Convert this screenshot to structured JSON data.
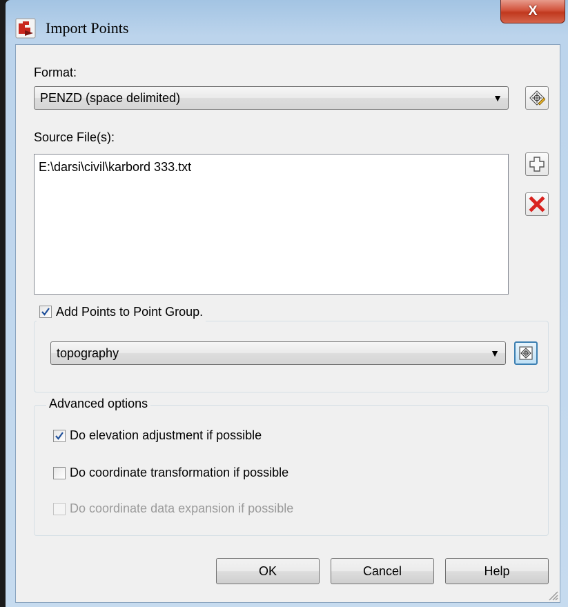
{
  "window": {
    "title": "Import Points",
    "close_label": "X"
  },
  "format": {
    "label": "Format:",
    "selected": "PENZD (space delimited)"
  },
  "source_files": {
    "label": "Source File(s):",
    "items": [
      "E:\\darsi\\civil\\karbord 333.txt"
    ]
  },
  "point_group": {
    "checkbox_label": "Add Points to Point Group.",
    "checked": true,
    "selected": "topography"
  },
  "advanced": {
    "legend": "Advanced options",
    "options": [
      {
        "label": "Do elevation adjustment if possible",
        "checked": true,
        "enabled": true
      },
      {
        "label": "Do coordinate transformation if possible",
        "checked": false,
        "enabled": true
      },
      {
        "label": "Do coordinate data expansion if possible",
        "checked": false,
        "enabled": false
      }
    ]
  },
  "buttons": {
    "ok": "OK",
    "cancel": "Cancel",
    "help": "Help"
  },
  "icons": {
    "app": "civil3d-app-icon",
    "format_edit": "format-edit-icon",
    "add_file": "add-file-icon",
    "remove_file": "remove-file-icon",
    "pick_group": "point-group-pick-icon"
  },
  "colors": {
    "title_gradient": "#bcd4ec",
    "close_red": "#c0381e",
    "remove_red": "#d9231f",
    "check_blue": "#1e4f9a",
    "focus_blue": "#3c7fb1"
  }
}
